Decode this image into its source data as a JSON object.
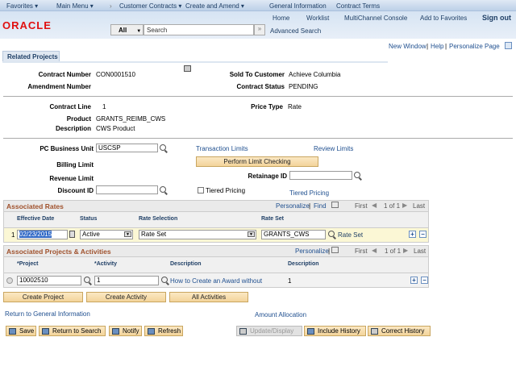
{
  "nav": {
    "favorites": "Favorites ▾",
    "main_menu": "Main Menu ▾",
    "crumbs": [
      "Customer Contracts ▾",
      "Create and Amend ▾",
      "General Information",
      "Contract Terms"
    ]
  },
  "header": {
    "logo": "ORACLE",
    "links": [
      "Home",
      "Worklist",
      "MultiChannel Console",
      "Add to Favorites"
    ],
    "sign_out": "Sign out",
    "search_scope": "All",
    "search_placeholder": "Search",
    "advanced_search": "Advanced Search"
  },
  "page_links": {
    "new_window": "New Window",
    "help": "Help",
    "personalize": "Personalize Page"
  },
  "tab": "Related Projects",
  "fields": {
    "contract_number": {
      "label": "Contract Number",
      "value": "CON0001510"
    },
    "sold_to": {
      "label": "Sold To Customer",
      "value": "Achieve Columbia"
    },
    "amendment": {
      "label": "Amendment Number"
    },
    "status": {
      "label": "Contract Status",
      "value": "PENDING"
    },
    "contract_line": {
      "label": "Contract Line",
      "value": "1"
    },
    "price_type": {
      "label": "Price Type",
      "value": "Rate"
    },
    "product": {
      "label": "Product",
      "value": "GRANTS_REIMB_CWS"
    },
    "description": {
      "label": "Description",
      "value": "CWS Product"
    },
    "pc_bu": {
      "label": "PC Business Unit",
      "value": "USCSP"
    },
    "transaction_limits": "Transaction Limits",
    "review_limits": "Review Limits",
    "billing_limit": "Billing Limit",
    "perform_limit": "Perform Limit Checking",
    "revenue_limit": "Revenue Limit",
    "retainage": {
      "label": "Retainage ID",
      "value": ""
    },
    "discount": {
      "label": "Discount ID",
      "value": ""
    },
    "tiered_checkbox": "Tiered Pricing",
    "tiered_link": "Tiered Pricing"
  },
  "rates": {
    "title": "Associated Rates",
    "personalize": "Personalize",
    "find": "Find",
    "first": "First",
    "count": "1 of 1",
    "last": "Last",
    "columns": [
      "Effective Date",
      "Status",
      "Rate Selection",
      "Rate Set"
    ],
    "row": {
      "num": "1",
      "date": "02/23/2015",
      "status": "Active",
      "selection": "Rate Set",
      "rate_set": "GRANTS_CWS",
      "rate_set_desc": "Rate Set"
    }
  },
  "projects": {
    "title": "Associated Projects & Activities",
    "personalize": "Personalize",
    "first": "First",
    "count": "1 of 1",
    "last": "Last",
    "columns": [
      "*Project",
      "*Activity",
      "Description",
      "Description"
    ],
    "row": {
      "project": "10002510",
      "activity": "1",
      "desc1": "How to Create an Award without",
      "desc2": "1"
    }
  },
  "buttons": {
    "create_project": "Create Project",
    "create_activity": "Create Activity",
    "all_activities": "All Activities"
  },
  "return_general": "Return to General Information",
  "amount_allocation": "Amount Allocation",
  "toolbar": {
    "save": "Save",
    "return": "Return to Search",
    "notify": "Notify",
    "refresh": "Refresh",
    "update": "Update/Display",
    "include": "Include History",
    "correct": "Correct History"
  }
}
